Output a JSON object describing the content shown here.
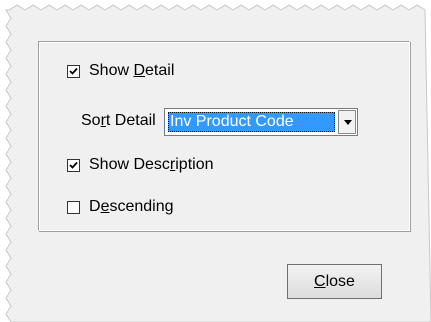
{
  "options": {
    "show_detail": {
      "checked": true,
      "label_pre": "Show ",
      "label_key": "D",
      "label_post": "etail"
    },
    "sort_detail": {
      "label_pre": "So",
      "label_key": "r",
      "label_post": "t Detail",
      "selected_value": "Inv Product Code"
    },
    "show_description": {
      "checked": true,
      "label_pre": "Show Desc",
      "label_key": "r",
      "label_post": "iption"
    },
    "descending": {
      "checked": false,
      "label_pre": "D",
      "label_key": "e",
      "label_post": "scending"
    }
  },
  "actions": {
    "close": {
      "label_key": "C",
      "label_post": "lose"
    }
  },
  "colors": {
    "selection_highlight": "#3399ff",
    "dialog_background": "#f0f0f0"
  }
}
